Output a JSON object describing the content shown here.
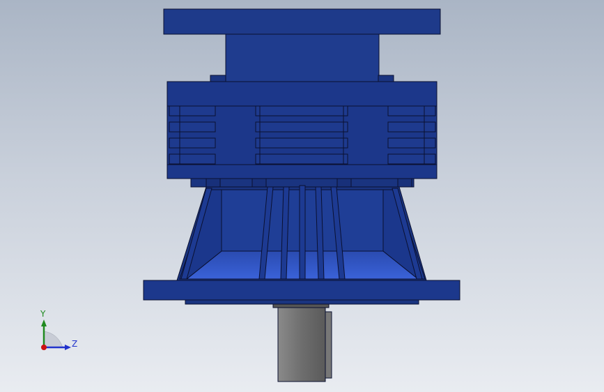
{
  "viewport": {
    "background_top": "#aab5c5",
    "background_bottom": "#e9ecf1"
  },
  "model": {
    "body_color": "#1e3a8a",
    "body_dark": "#142a6b",
    "body_light": "#2d4fb4",
    "outline_color": "#0a1030",
    "shaft_color": "#7a7a7a"
  },
  "triad": {
    "y_label": "Y",
    "z_label": "Z",
    "y_color": "#1f8a1f",
    "z_color": "#2233cc",
    "x_color": "#cc1111"
  }
}
